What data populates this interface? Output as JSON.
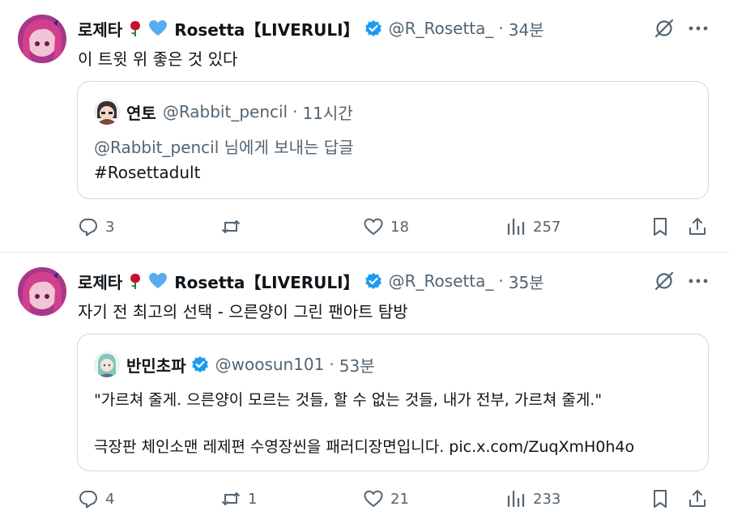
{
  "tweets": [
    {
      "author": {
        "name": "로제타",
        "display_name": "Rosetta【LIVERULI】",
        "handle": "@R_Rosetta_",
        "time": "34분",
        "emoji": [
          "rose-icon",
          "blue-heart-icon"
        ]
      },
      "text": "이 트윗 위 좋은 것 있다",
      "quote": {
        "name": "연토",
        "handle": "@Rabbit_pencil",
        "time": "11시간",
        "lines": [
          "@Rabbit_pencil 님에게 보내는 답글",
          "#Rosettadult"
        ]
      },
      "stats": {
        "replies": "3",
        "retweets": "",
        "likes": "18",
        "views": "257"
      }
    },
    {
      "author": {
        "name": "로제타",
        "display_name": "Rosetta【LIVERULI】",
        "handle": "@R_Rosetta_",
        "time": "35분",
        "emoji": [
          "rose-icon",
          "blue-heart-icon"
        ]
      },
      "text": "자기 전 최고의 선택 - 으른양이 그린 팬아트 탐방",
      "quote": {
        "name": "반민초파",
        "handle": "@woosun101",
        "time": "53분",
        "lines": [
          "\"가르쳐 줄게. 으른양이 모르는 것들, 할 수 없는 것들, 내가 전부, 가르쳐 줄게.\"",
          "극장판 체인소맨 레제편 수영장씬을 패러디장면입니다. pic.x.com/ZuqXmH0h4o"
        ]
      },
      "stats": {
        "replies": "4",
        "retweets": "1",
        "likes": "21",
        "views": "233"
      }
    }
  ],
  "colors": {
    "muted": "#536471",
    "text": "#0f1419",
    "verified": "#1d9bf0",
    "border": "#cfd9de",
    "rose": "#c8102e"
  }
}
